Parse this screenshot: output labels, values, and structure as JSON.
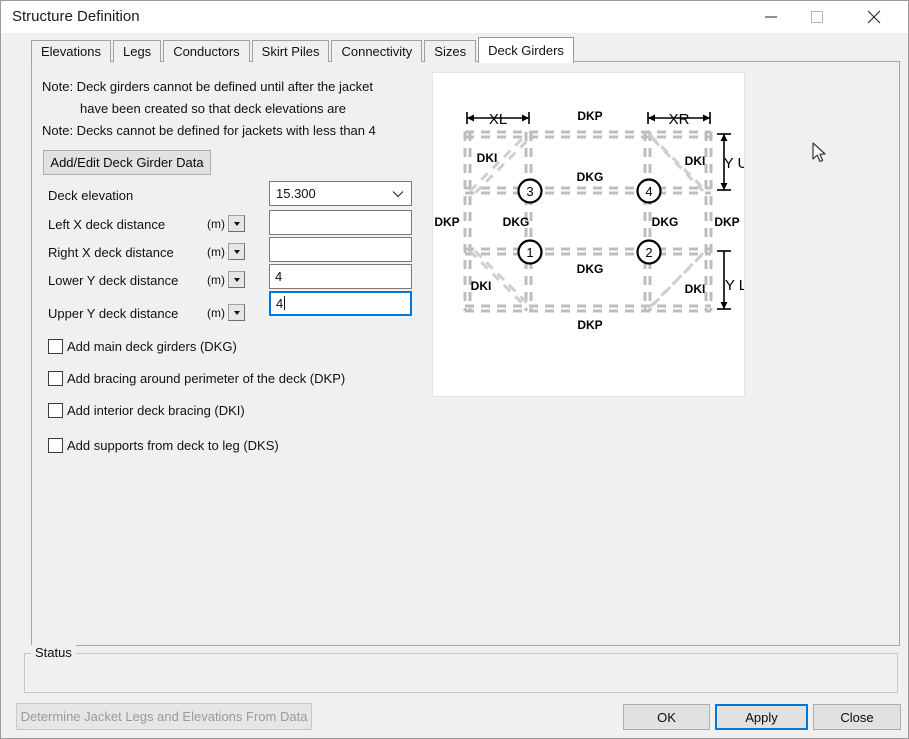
{
  "window": {
    "title": "Structure Definition",
    "minimize_label": "minimize",
    "maximize_label": "maximize",
    "close_label": "close"
  },
  "tabs": [
    {
      "label": "Elevations",
      "active": false
    },
    {
      "label": "Legs",
      "active": false
    },
    {
      "label": "Conductors",
      "active": false
    },
    {
      "label": "Skirt Piles",
      "active": false
    },
    {
      "label": "Connectivity",
      "active": false
    },
    {
      "label": "Sizes",
      "active": false
    },
    {
      "label": "Deck Girders",
      "active": true
    }
  ],
  "deck_girders": {
    "notes": [
      "Note: Deck girders cannot be defined until after the jacket",
      "have been created so that deck elevations are",
      "Note: Decks cannot be defined for jackets with less than 4"
    ],
    "add_edit_button": "Add/Edit Deck Girder Data",
    "fields": [
      {
        "label": "Deck elevation",
        "unit": "",
        "value": "15.300",
        "type": "combo",
        "focused": false
      },
      {
        "label": "Left X deck distance",
        "unit": "(m)",
        "value": "",
        "type": "text",
        "focused": false
      },
      {
        "label": "Right X deck distance",
        "unit": "(m)",
        "value": "",
        "type": "text",
        "focused": false
      },
      {
        "label": "Lower Y deck distance",
        "unit": "(m)",
        "value": "4",
        "type": "text",
        "focused": false
      },
      {
        "label": "Upper Y deck distance",
        "unit": "(m)",
        "value": "4",
        "type": "text",
        "focused": true
      }
    ],
    "checkboxes": [
      {
        "label": "Add main deck girders (DKG)",
        "checked": false
      },
      {
        "label": "Add bracing around perimeter of the deck (DKP)",
        "checked": false
      },
      {
        "label": "Add interior deck bracing (DKI)",
        "checked": false
      },
      {
        "label": "Add supports from deck to leg (DKS)",
        "checked": false
      }
    ],
    "diagram": {
      "dimension_labels": {
        "xl": "XL",
        "xr": "XR",
        "yu": "Y U",
        "yl": "Y L"
      },
      "member_labels": {
        "perimeter": "DKP",
        "girder": "DKG",
        "interior": "DKI"
      },
      "node_numbers": [
        "1",
        "2",
        "3",
        "4"
      ],
      "perimeter_label_positions": [
        "top",
        "bottom",
        "left",
        "right"
      ],
      "line_color": "#bdbdbd",
      "text_color": "#000000"
    }
  },
  "status": {
    "group_label": "Status",
    "message": ""
  },
  "footer": {
    "determine_label": "Determine Jacket Legs and Elevations From Data",
    "determine_enabled": false,
    "ok_label": "OK",
    "apply_label": "Apply",
    "close_label": "Close",
    "accent_color": "#0078d7"
  }
}
